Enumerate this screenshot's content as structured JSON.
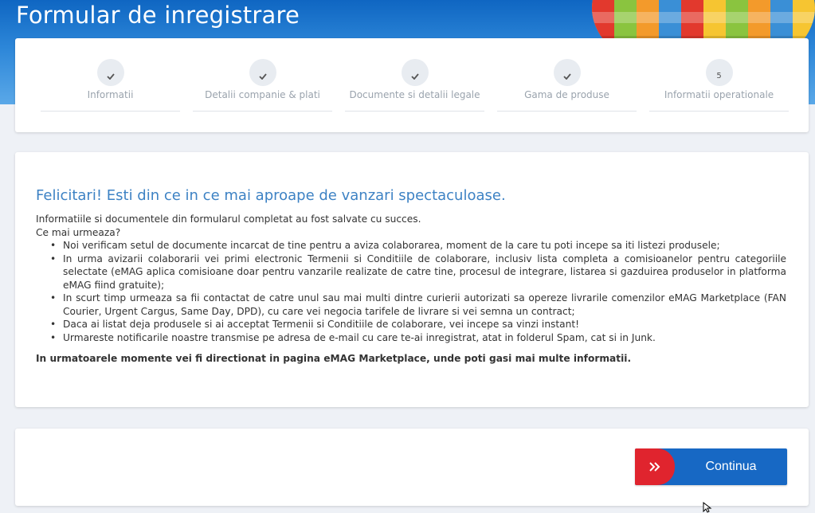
{
  "header": {
    "title": "Formular de inregistrare"
  },
  "steps": [
    {
      "label": "Informatii",
      "status": "done",
      "marker": ""
    },
    {
      "label": "Detalii companie & plati",
      "status": "done",
      "marker": ""
    },
    {
      "label": "Documente si detalii legale",
      "status": "done",
      "marker": ""
    },
    {
      "label": "Gama de produse",
      "status": "done",
      "marker": ""
    },
    {
      "label": "Informatii operationale",
      "status": "current",
      "marker": "5"
    }
  ],
  "content": {
    "headline": "Felicitari! Esti din ce in ce mai aproape de vanzari spectaculoase.",
    "intro": "Informatiile si documentele din formularul completat au fost salvate cu succes.",
    "subheading": "Ce mai urmeaza?",
    "bullets": [
      "Noi verificam setul de documente incarcat de tine pentru a aviza colaborarea, moment de la care tu poti incepe sa iti listezi produsele;",
      "In urma avizarii colaborarii vei primi electronic Termenii si Conditiile de colaborare, inclusiv lista completa a comisioanelor pentru categoriile selectate (eMAG aplica comisioane doar pentru vanzarile realizate de catre tine, procesul de integrare, listarea si gazduirea produselor in platforma eMAG fiind gratuite);",
      "In scurt timp urmeaza sa fii contactat de catre unul sau mai multi dintre curierii autorizati sa opereze livrarile comenzilor eMAG Marketplace (FAN Courier, Urgent Cargus, Same Day, DPD), cu care vei negocia tarifele de livrare si vei semna un contract;",
      "Daca ai listat deja produsele si ai acceptat Termenii si Conditiile de colaborare, vei incepe sa vinzi instant!",
      "Urmareste notificarile noastre transmise pe adresa de e-mail cu care te-ai inregistrat, atat in folderul Spam, cat si in Junk."
    ],
    "final_note": "In urmatoarele momente vei fi directionat in pagina eMAG Marketplace, unde poti gasi mai multe informatii."
  },
  "footer": {
    "continue_label": "Continua"
  },
  "colors": {
    "header_blue": "#0f66c2",
    "headline_blue": "#3d82c4",
    "button_blue": "#1768c4",
    "button_red": "#e0242e"
  },
  "icons": {
    "step_done": "check-icon",
    "button_arrows": "double-chevron-right-icon",
    "cursor": "mouse-pointer-icon"
  }
}
